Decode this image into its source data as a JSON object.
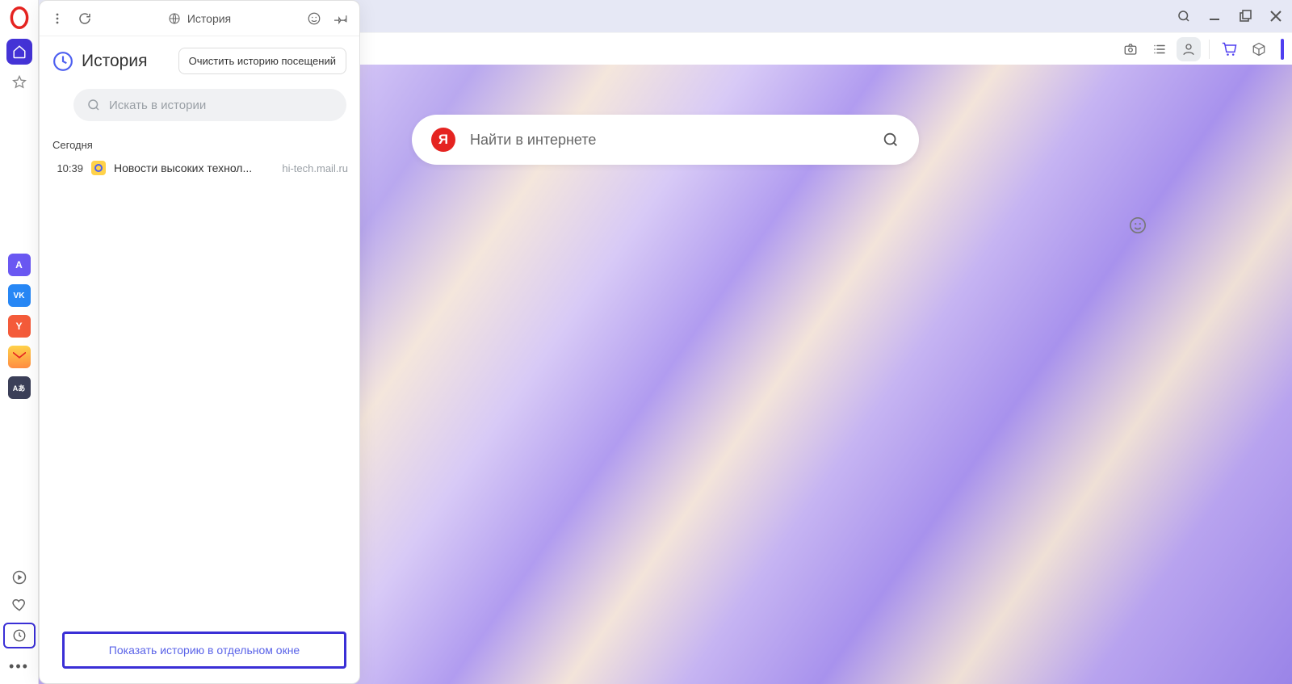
{
  "sidebar": {
    "apps": [
      {
        "name": "aria",
        "bg": "#6a58f2",
        "label": "A"
      },
      {
        "name": "vk",
        "bg": "#2787f5",
        "label": "VK"
      },
      {
        "name": "yandex",
        "bg": "#f45b3a",
        "label": "Y"
      },
      {
        "name": "mail",
        "bg": "#ffd24a",
        "label": ""
      },
      {
        "name": "translate",
        "bg": "#3b3f58",
        "label": "Aあ"
      }
    ]
  },
  "titlebar": {},
  "content": {
    "search_placeholder": "Найти в интернете"
  },
  "history_panel": {
    "top_title": "История",
    "header_title": "История",
    "clear_label": "Очистить историю посещений",
    "search_placeholder": "Искать в истории",
    "section_today": "Сегодня",
    "items": [
      {
        "time": "10:39",
        "title": "Новости высоких технол...",
        "host": "hi-tech.mail.ru"
      }
    ],
    "footer_link": "Показать историю в отдельном окне"
  }
}
